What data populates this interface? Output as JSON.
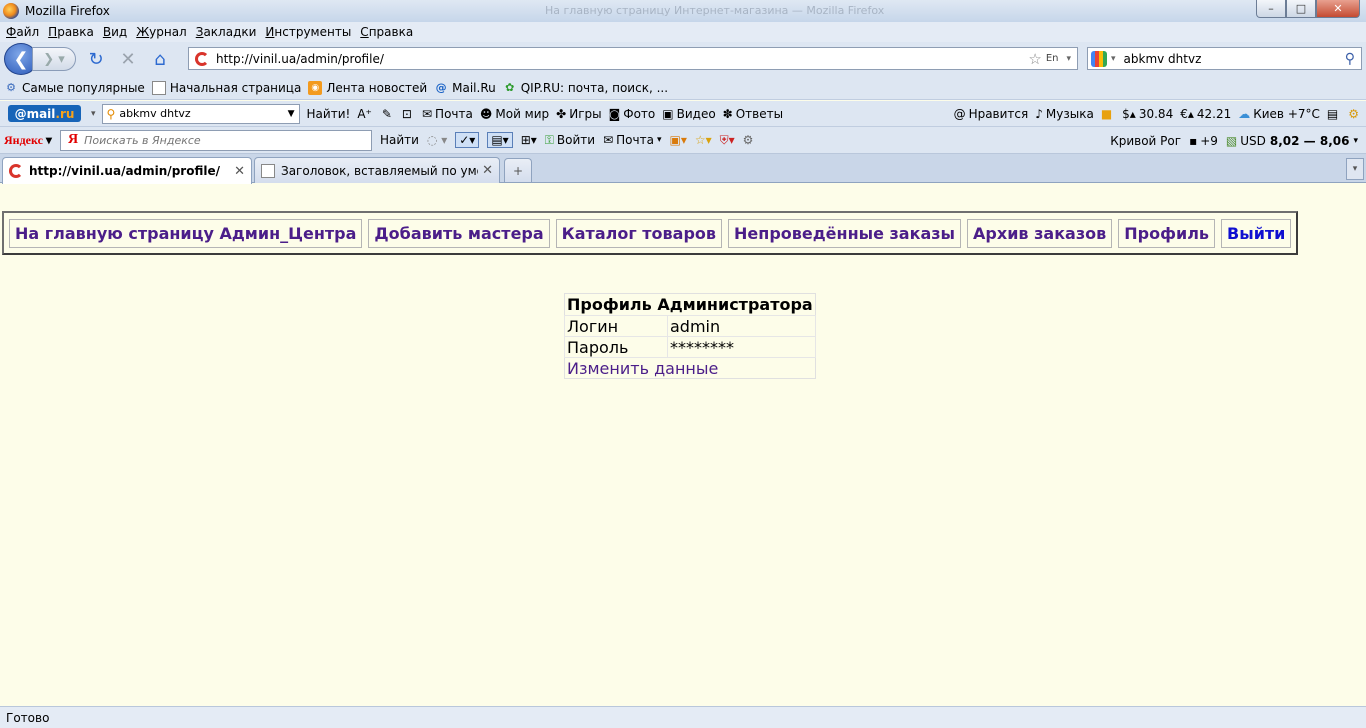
{
  "window": {
    "title": "Mozilla Firefox",
    "ghost_title": "На главную страницу Интернет-магазина — Mozilla Firefox",
    "minimize": "–",
    "maximize": "□",
    "close": "✕"
  },
  "menu": [
    "Файл",
    "Правка",
    "Вид",
    "Журнал",
    "Закладки",
    "Инструменты",
    "Справка"
  ],
  "nav": {
    "url": "http://vinil.ua/admin/profile/",
    "lang": "En",
    "search_value": "abkmv dhtvz"
  },
  "bookmarks": [
    {
      "icon": "popular-icon",
      "label": "Самые популярные"
    },
    {
      "icon": "page-icon",
      "label": "Начальная страница"
    },
    {
      "icon": "rss-icon",
      "label": "Лента новостей"
    },
    {
      "icon": "at-icon",
      "label": "Mail.Ru"
    },
    {
      "icon": "qip-icon",
      "label": "QIP.RU: почта, поиск, ..."
    }
  ],
  "mailbar": {
    "logo_pre": "@mail",
    "logo_post": ".ru",
    "search_value": "abkmv dhtvz",
    "find": "Найти!",
    "items": [
      "Почта",
      "Мой мир",
      "Игры",
      "Фото",
      "Видео",
      "Ответы"
    ],
    "right": {
      "like": "Нравится",
      "music": "Музыка",
      "usd": "30.84",
      "eur": "42.21",
      "weather": "Киев +7°C"
    }
  },
  "yabar": {
    "logo": "Яндекс",
    "placeholder": "Поискать в Яндексе",
    "find": "Найти",
    "login": "Войти",
    "mail": "Почта",
    "city": "Кривой Рог",
    "temp": "+9",
    "usd_prefix": "USD",
    "usd_rate": "8,02 — 8,06"
  },
  "tabs": [
    {
      "title": "http://vinil.ua/admin/profile/",
      "active": true
    },
    {
      "title": "Заголовок, вставляемый по умол...",
      "active": false
    }
  ],
  "page": {
    "admin_nav": [
      "На главную страницу Админ_Центра",
      "Добавить мастера",
      "Каталог товаров",
      "Непроведённые заказы",
      "Архив заказов",
      "Профиль",
      "Выйти"
    ],
    "profile": {
      "title": "Профиль Администратора",
      "login_label": "Логин",
      "login_value": "admin",
      "password_label": "Пароль",
      "password_value": "********",
      "edit_link": "Изменить данные"
    }
  },
  "status": "Готово"
}
